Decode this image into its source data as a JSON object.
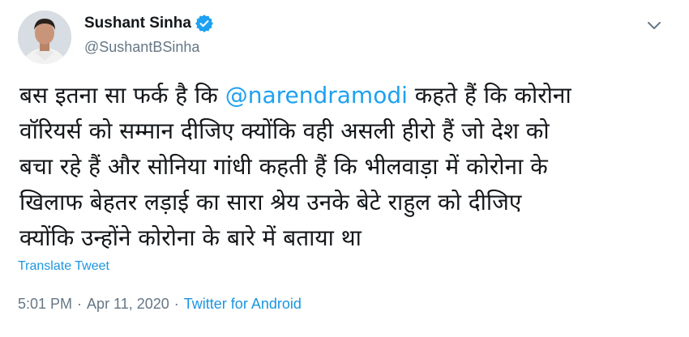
{
  "user": {
    "display_name": "Sushant Sinha",
    "handle": "@SushantBSinha",
    "verified_icon": "verified-badge-icon"
  },
  "menu": {
    "icon": "chevron-down-icon"
  },
  "tweet": {
    "lines": {
      "0": {
        "pre": "बस इतना सा फर्क है कि ",
        "mention": "@narendramodi",
        "post": " कहते हैं कि कोरोना"
      },
      "1": "वॉरियर्स को सम्मान दीजिए क्योंकि वही असली हीरो हैं जो देश को",
      "2": "बचा रहे हैं और सोनिया गांधी कहती हैं कि भीलवाड़ा में कोरोना के",
      "3": "खिलाफ बेहतर लड़ाई का सारा श्रेय उनके बेटे राहुल को दीजिए",
      "4": "क्योंकि उन्होंने कोरोना के बारे में बताया था"
    },
    "translate_label": "Translate Tweet"
  },
  "meta": {
    "time": "5:01 PM",
    "separator1": "·",
    "date": "Apr 11, 2020",
    "separator2": "·",
    "source": "Twitter for Android"
  },
  "colors": {
    "link": "#1da1f2",
    "verified": "#1da1f2",
    "secondary_text": "#657786",
    "primary_text": "#14171a"
  }
}
